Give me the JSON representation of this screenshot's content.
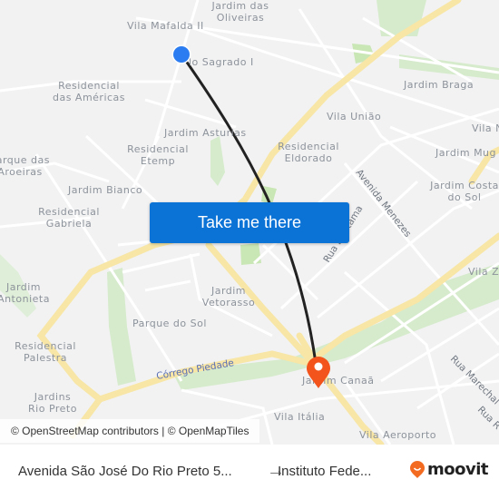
{
  "map": {
    "neighborhood_labels": [
      {
        "id": "jardim-das-oliveiras",
        "lines": [
          "Jardim das",
          "Oliveiras"
        ]
      },
      {
        "id": "vila-mafalda-ii",
        "lines": [
          "Vila Mafalda II"
        ]
      },
      {
        "id": "sagrado-i",
        "lines": [
          "lo Sagrado I"
        ]
      },
      {
        "id": "residencial-das-americas",
        "lines": [
          "Residencial",
          "das Américas"
        ]
      },
      {
        "id": "jardim-braga",
        "lines": [
          "Jardim Braga"
        ]
      },
      {
        "id": "vila-uniao",
        "lines": [
          "Vila União"
        ]
      },
      {
        "id": "vila-n",
        "lines": [
          "Vila N"
        ]
      },
      {
        "id": "jardim-asturias",
        "lines": [
          "Jardim Asturias"
        ]
      },
      {
        "id": "residencial-etemp",
        "lines": [
          "Residencial",
          "Etemp"
        ]
      },
      {
        "id": "residencial-eldorado",
        "lines": [
          "Residencial",
          "Eldorado"
        ]
      },
      {
        "id": "jardim-mug",
        "lines": [
          "Jardim Mug"
        ]
      },
      {
        "id": "parque-das-aroeiras",
        "lines": [
          "Parque das",
          "Aroeiras"
        ]
      },
      {
        "id": "jardim-bianco",
        "lines": [
          "Jardim Bianco"
        ]
      },
      {
        "id": "jardim-costa-do-sol",
        "lines": [
          "Jardim Costa",
          "do Sol"
        ]
      },
      {
        "id": "residencial-gabriela",
        "lines": [
          "Residencial",
          "Gabriela"
        ]
      },
      {
        "id": "vila-z",
        "lines": [
          "Vila Z"
        ]
      },
      {
        "id": "jardim-antonieta",
        "lines": [
          "Jardim",
          "Antonieta"
        ]
      },
      {
        "id": "jardim-vetorasso",
        "lines": [
          "Jardim",
          "Vetorasso"
        ]
      },
      {
        "id": "parque-do-sol",
        "lines": [
          "Parque do Sol"
        ]
      },
      {
        "id": "residencial-palestra",
        "lines": [
          "Residencial",
          "Palestra"
        ]
      },
      {
        "id": "jardim-canaa",
        "lines": [
          "Jardim Canaã"
        ]
      },
      {
        "id": "jardins-rio-preto",
        "lines": [
          "Jardins",
          "Rio Preto"
        ]
      },
      {
        "id": "vila-italia",
        "lines": [
          "Vila Itália"
        ]
      },
      {
        "id": "vila-aeroporto",
        "lines": [
          "Vila Aeroporto"
        ]
      }
    ],
    "street_labels": {
      "avenida_menezes": "Avenida Menezes",
      "rua_buritama": "Rua Buritama",
      "rua_marechal": "Rua Marechal",
      "rua_r": "Rua R"
    },
    "water_label": "Córrego Piedade",
    "origin_marker": {
      "color": "#2b7cf0"
    },
    "destination_marker": {
      "color": "#f2541b"
    },
    "colors": {
      "background": "#f2f2f3",
      "major_road": "#f7e6a6",
      "park": "#d6ebcc",
      "route": "#222222"
    }
  },
  "cta": {
    "label": "Take me there",
    "color": "#0b72d6"
  },
  "attribution": "© OpenStreetMap contributors | © OpenMapTiles",
  "footer": {
    "from": "Avenida São José Do Rio Preto 5...",
    "arrow": "→",
    "to": "Instituto Fede...",
    "brand": "moovit",
    "brand_color": "#f26b21"
  }
}
